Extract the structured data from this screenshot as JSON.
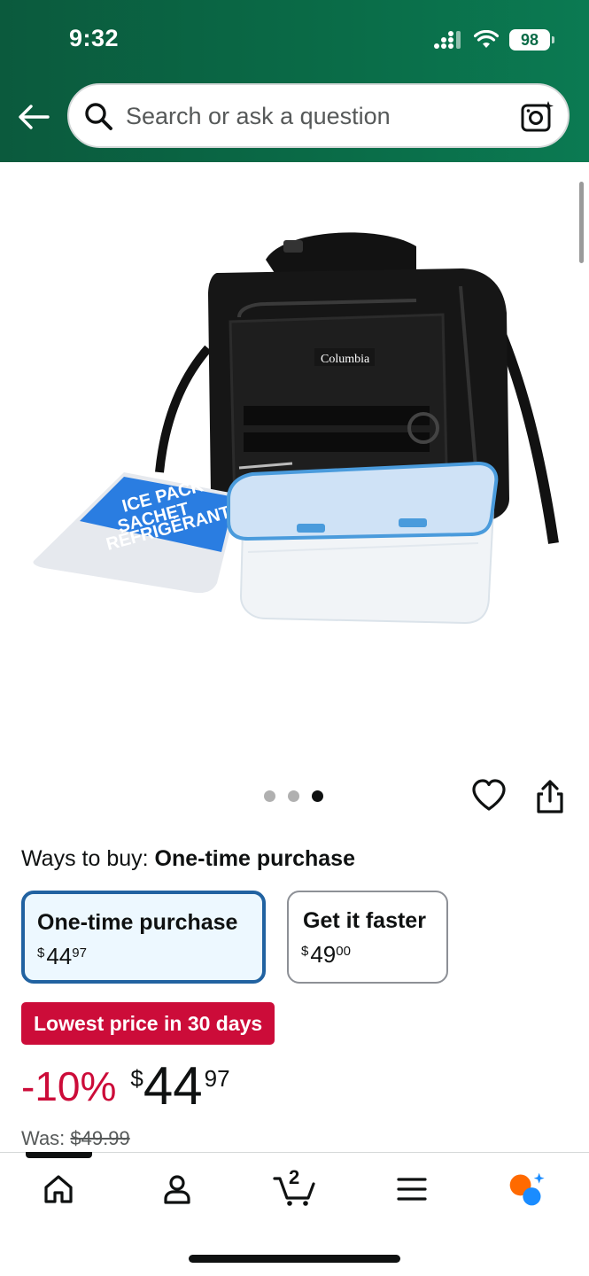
{
  "status_bar": {
    "time": "9:32",
    "battery": "98"
  },
  "search": {
    "placeholder": "Search or ask a question"
  },
  "product": {
    "image_brand_logo": "Columbia",
    "image_ice_pack_lines": [
      "ICE PACK",
      "SACHET",
      "RÉFRIGÉRANT"
    ],
    "carousel": {
      "count": 3,
      "active_index": 2
    }
  },
  "ways_to_buy": {
    "label": "Ways to buy:",
    "selected": "One-time purchase",
    "options": [
      {
        "title": "One-time purchase",
        "currency": "$",
        "whole": "44",
        "fraction": "97",
        "selected": true
      },
      {
        "title": "Get it faster",
        "currency": "$",
        "whole": "49",
        "fraction": "00",
        "selected": false
      }
    ]
  },
  "deal": {
    "badge": "Lowest price in 30 days",
    "discount": "-10%",
    "currency": "$",
    "whole": "44",
    "fraction": "97",
    "was_label": "Was:",
    "was_price": "$49.99"
  },
  "bottom_nav": {
    "cart_count": "2",
    "items": [
      "home-icon",
      "account-icon",
      "cart-icon",
      "menu-icon",
      "rufus-ai-icon"
    ]
  },
  "colors": {
    "header_green": "#0a6b47",
    "deal_red": "#cc0c39",
    "selected_border": "#2162a1"
  }
}
